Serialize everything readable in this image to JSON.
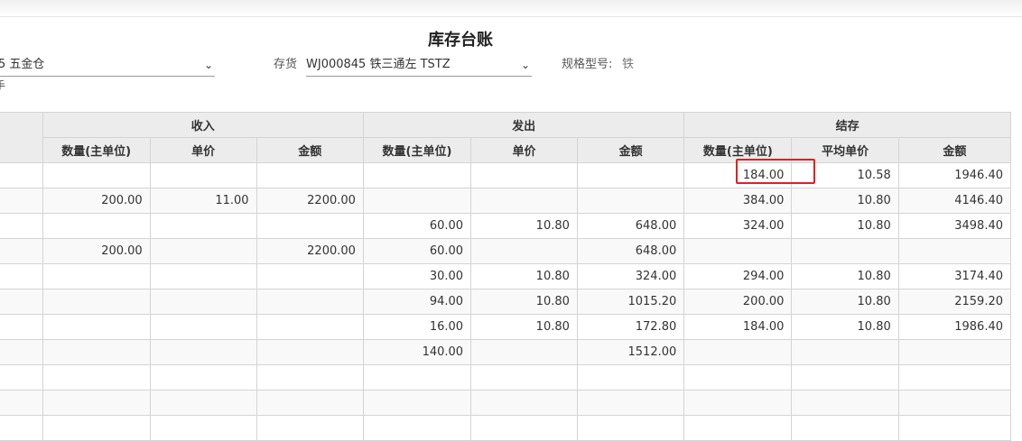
{
  "page": {
    "title": "库存台账",
    "warehouse_value": "5 五金仓",
    "inventory_label": "存货",
    "inventory_value": "WJ000845 铁三通左 TSTZ",
    "spec_label": "规格型号:",
    "spec_value": "铁",
    "cut_fragment": "手"
  },
  "table": {
    "groups": [
      "收入",
      "发出",
      "结存"
    ],
    "columns": [
      "数量(主单位)",
      "单价",
      "金额",
      "数量(主单位)",
      "单价",
      "金额",
      "数量(主单位)",
      "平均单价",
      "金额"
    ],
    "rows": [
      [
        "",
        "",
        "",
        "",
        "",
        "",
        "184.00",
        "10.58",
        "1946.40"
      ],
      [
        "200.00",
        "11.00",
        "2200.00",
        "",
        "",
        "",
        "384.00",
        "10.80",
        "4146.40"
      ],
      [
        "",
        "",
        "",
        "60.00",
        "10.80",
        "648.00",
        "324.00",
        "10.80",
        "3498.40"
      ],
      [
        "200.00",
        "",
        "2200.00",
        "60.00",
        "",
        "648.00",
        "",
        "",
        ""
      ],
      [
        "",
        "",
        "",
        "30.00",
        "10.80",
        "324.00",
        "294.00",
        "10.80",
        "3174.40"
      ],
      [
        "",
        "",
        "",
        "94.00",
        "10.80",
        "1015.20",
        "200.00",
        "10.80",
        "2159.20"
      ],
      [
        "",
        "",
        "",
        "16.00",
        "10.80",
        "172.80",
        "184.00",
        "10.80",
        "1986.40"
      ],
      [
        "",
        "",
        "",
        "140.00",
        "",
        "1512.00",
        "",
        "",
        ""
      ],
      [
        "",
        "",
        "",
        "",
        "",
        "",
        "",
        "",
        ""
      ],
      [
        "",
        "",
        "",
        "",
        "",
        "",
        "",
        "",
        ""
      ],
      [
        "",
        "",
        "",
        "",
        "",
        "",
        "",
        "",
        ""
      ]
    ]
  },
  "icons": {
    "dropdown": "chevron-down-icon"
  },
  "colors": {
    "highlight": "#e02020",
    "header_bg": "#ececec"
  }
}
